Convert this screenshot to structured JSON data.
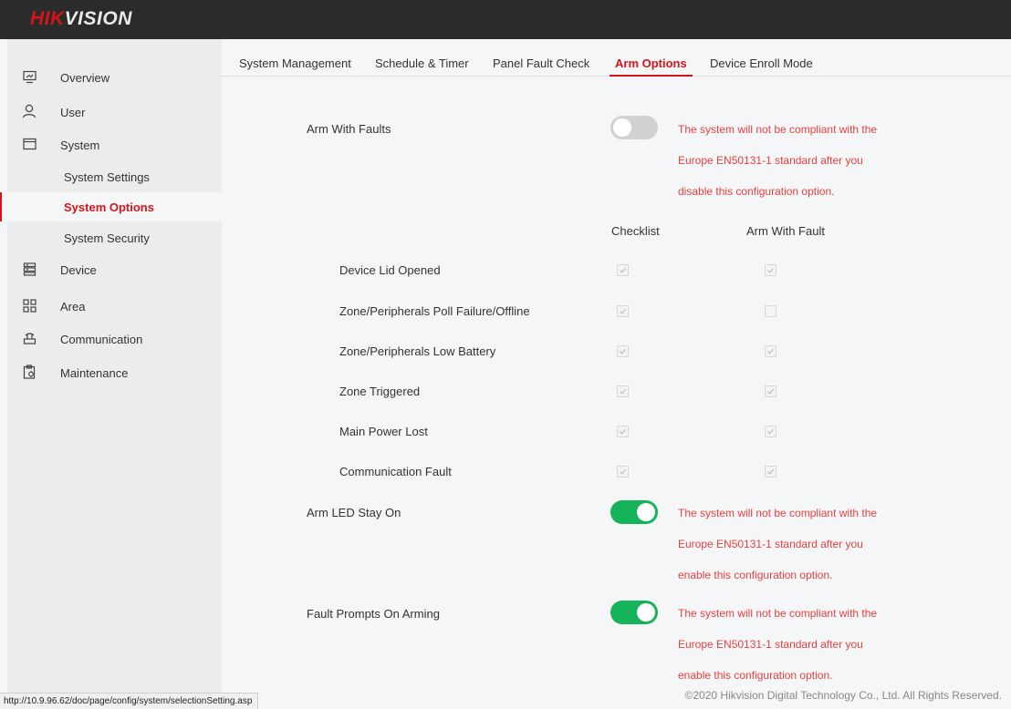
{
  "header": {
    "logo_part1": "HIK",
    "logo_part2": "VISION",
    "brand_color": "#d7141a"
  },
  "sidebar": {
    "items": [
      {
        "label": "Overview",
        "icon": "monitor-icon"
      },
      {
        "label": "User",
        "icon": "user-icon"
      },
      {
        "label": "System",
        "icon": "window-icon"
      },
      {
        "label": "Device",
        "icon": "device-icon"
      },
      {
        "label": "Area",
        "icon": "grid-icon"
      },
      {
        "label": "Communication",
        "icon": "router-icon"
      },
      {
        "label": "Maintenance",
        "icon": "clipboard-gear-icon"
      }
    ],
    "system_sub": [
      {
        "label": "System Settings",
        "active": false
      },
      {
        "label": "System Options",
        "active": true
      },
      {
        "label": "System Security",
        "active": false
      }
    ]
  },
  "tabs": [
    {
      "label": "System Management",
      "active": false
    },
    {
      "label": "Schedule & Timer",
      "active": false
    },
    {
      "label": "Panel Fault Check",
      "active": false
    },
    {
      "label": "Arm Options",
      "active": true
    },
    {
      "label": "Device Enroll Mode",
      "active": false
    }
  ],
  "options": {
    "arm_with_faults": {
      "label": "Arm With Faults",
      "enabled": false,
      "warning": [
        "The system will not be compliant with the",
        "Europe EN50131-1 standard after you",
        "disable this configuration option."
      ]
    },
    "arm_led": {
      "label": "Arm LED Stay On",
      "enabled": true,
      "warning": [
        "The system will not be compliant with the",
        "Europe EN50131-1 standard after you",
        "enable this configuration option."
      ]
    },
    "fault_prompts": {
      "label": "Fault Prompts On Arming",
      "enabled": true,
      "warning": [
        "The system will not be compliant with the",
        "Europe EN50131-1 standard after you",
        "enable this configuration option."
      ]
    }
  },
  "fault_table": {
    "col_checklist": "Checklist",
    "col_arm_with_fault": "Arm With Fault",
    "rows": [
      {
        "label": "Device Lid Opened",
        "checklist": true,
        "arm_with_fault": true
      },
      {
        "label": "Zone/Peripherals Poll Failure/Offline",
        "checklist": true,
        "arm_with_fault": false
      },
      {
        "label": "Zone/Peripherals Low Battery",
        "checklist": true,
        "arm_with_fault": true
      },
      {
        "label": "Zone Triggered",
        "checklist": true,
        "arm_with_fault": true
      },
      {
        "label": "Main Power Lost",
        "checklist": true,
        "arm_with_fault": true
      },
      {
        "label": "Communication Fault",
        "checklist": true,
        "arm_with_fault": true
      }
    ]
  },
  "status_url": "http://10.9.96.62/doc/page/config/system/selectionSetting.asp",
  "footer": "©2020 Hikvision Digital Technology Co., Ltd. All Rights Reserved.",
  "colors": {
    "accent": "#d7141a",
    "toggle_on": "#17b35a",
    "toggle_off": "#d1d1d1",
    "warning": "#e8403f"
  }
}
